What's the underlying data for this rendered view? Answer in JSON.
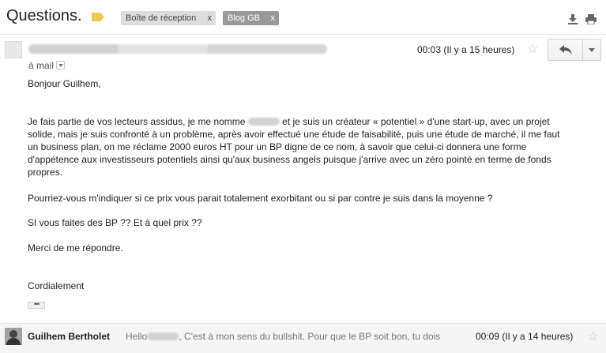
{
  "thread": {
    "subject": "Questions.",
    "labels": [
      {
        "name": "Boîte de réception",
        "remove": "x"
      },
      {
        "name": "Blog GB",
        "remove": "x"
      }
    ]
  },
  "icons": {
    "importance": "importance-marker-icon",
    "download": "download-icon",
    "print": "print-icon",
    "star": "star-icon",
    "reply": "reply-arrow-icon",
    "more": "chevron-down-icon"
  },
  "message1": {
    "to": "à mail",
    "time": "00:03 (Il y a 15 heures)",
    "star": "☆",
    "greeting": "Bonjour Guilhem,",
    "para1_a": "Je fais partie de vos lecteurs assidus, je me nomme",
    "para1_b": "et je suis un créateur « potentiel » d'une start-up, avec un projet solide, mais  je suis confronté à un problème, après avoir effectué une étude de faisabilité, puis une étude de marché, il me faut un business plan, on me réclame 2000 euros HT pour un BP digne de ce nom, à savoir que celui-ci donnera une forme d'appétence aux investisseurs potentiels ainsi qu'aux business angels puisque j'arrive avec un zéro pointé en terme de fonds propres.",
    "para2": "Pourriez-vous m'indiquer si ce prix vous parait totalement exorbitant ou si par contre je suis dans la moyenne ?",
    "para3": "SI vous faites des BP ?? Et à quel prix ??",
    "para4": "Merci de me répondre.",
    "closing": "Cordialement",
    "trimmed": "•••"
  },
  "message2": {
    "sender": "Guilhem Bertholet",
    "snippet_a": "Hello",
    "snippet_b": ", C'est à mon sens du bullshit. Pour que le BP soit bon, tu dois",
    "time": "00:09 (Il y a 14 heures)",
    "star": "☆"
  },
  "colors": {
    "label_inbox_bg": "#dddddd",
    "label_blog_bg": "#999999",
    "importance": "#f2c94c",
    "collapsed_bg": "#f5f5f5"
  }
}
